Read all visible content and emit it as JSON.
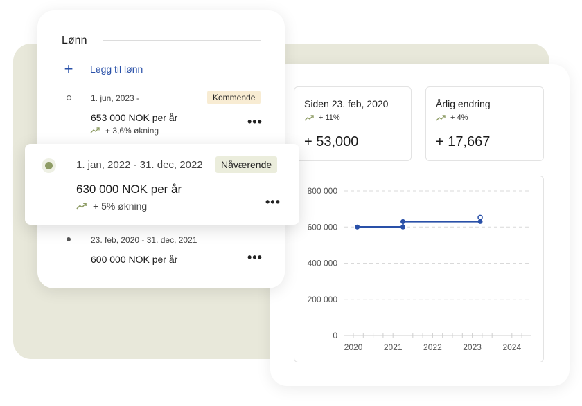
{
  "colors": {
    "accent_blue": "#2950a8",
    "olive_dot": "#8e9c65",
    "trend_green": "#8e9c65",
    "backdrop": "#e8e8da",
    "badge_upcoming": "#f8ecd3",
    "badge_current": "#ebeddc"
  },
  "salary_panel": {
    "title": "Lønn",
    "add_label": "Legg til lønn",
    "add_icon": "plus-icon",
    "more_icon": "more-horizontal-icon",
    "more_label": "•••",
    "entries": [
      {
        "date": "1. jun, 2023 -",
        "amount": "653 000 NOK per år",
        "change": "+ 3,6% økning",
        "badge": "Kommende"
      },
      {
        "date": "1. jan, 2022 - 31. dec, 2022",
        "amount": "630 000 NOK per år",
        "change": "+ 5% økning",
        "badge": "Nåværende"
      },
      {
        "date": "23. feb, 2020 - 31. dec, 2021",
        "amount": "600 000 NOK per år"
      }
    ]
  },
  "stats": [
    {
      "title": "Siden 23. feb, 2020",
      "change": "+ 11%",
      "value": "+ 53,000",
      "icon": "trend-up-icon"
    },
    {
      "title": "Årlig endring",
      "change": "+ 4%",
      "value": "+ 17,667",
      "icon": "trend-up-icon"
    }
  ],
  "chart_data": {
    "type": "line",
    "x_ticks": [
      "2020",
      "2021",
      "2022",
      "2023",
      "2024"
    ],
    "y_ticks": [
      "800 000",
      "600 000",
      "400 000",
      "200 000",
      "0"
    ],
    "xlim": [
      2020,
      2024.5
    ],
    "ylim": [
      0,
      800000
    ],
    "grid": true,
    "color": "#2950a8",
    "series": [
      {
        "points": [
          [
            2020.1,
            600000
          ],
          [
            2021.25,
            600000
          ],
          [
            2021.25,
            630000
          ],
          [
            2023.2,
            630000
          ]
        ],
        "future_point": [
          2023.2,
          653000
        ]
      }
    ]
  }
}
